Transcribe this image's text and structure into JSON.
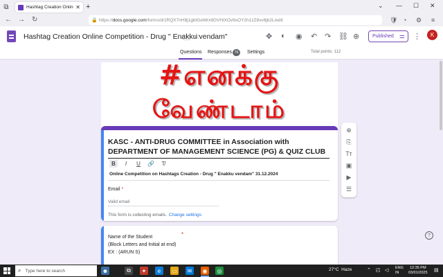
{
  "browser": {
    "tab_title": "Hashtag Creation Online Comp",
    "url_prefix": "https://",
    "url_domain": "docs.google.com",
    "url_path": "/forms/d/1RQX7nH8j1gbIGeWrx9GVHiXOv9sOY2h1zZ8vv8jb2L/edit"
  },
  "form_header": {
    "title": "Hashtag Creation Online Competition - Drug \" Enakku vendam\"",
    "publish_label": "Published",
    "avatar_letter": "K",
    "tabs": [
      {
        "label": "Questions"
      },
      {
        "label": "Responses"
      },
      {
        "label": "Settings"
      }
    ],
    "responses_count": "76",
    "total_points": "Total points: 112"
  },
  "banner": {
    "line1": "#எனக்கு",
    "line2": "வேண்டாம்"
  },
  "title_card": {
    "title": "KASC - ANTI-DRUG COMMITTEE in Association with DEPARTMENT OF MANAGEMENT SCIENCE (PG) & QUIZ CLUB",
    "format_tools": [
      "B",
      "I",
      "U",
      "🔗",
      "T̸"
    ],
    "description": "Online Competition on Hashtags Creation  - Drug \" Enakku vendam\"  31.12.2024",
    "email_label": "Email",
    "email_required": "*",
    "email_placeholder": "Valid email",
    "collecting_text": "This form is collecting emails.",
    "change_settings": "Change settings"
  },
  "question_card": {
    "line1": "Name of the Student",
    "line2": "(Block  Letters and Initial at end)",
    "line3": "EX : (ARUN S)",
    "required": "*"
  },
  "taskbar": {
    "search_placeholder": "Type here to search",
    "temperature": "27°C",
    "weather": "Haze",
    "lang1": "ENG",
    "lang2": "IN",
    "time": "12:35 PM",
    "date": "03/01/2025"
  },
  "colors": {
    "accent": "#673ab7",
    "banner_red": "#e51515",
    "focus_blue": "#4285f4"
  }
}
